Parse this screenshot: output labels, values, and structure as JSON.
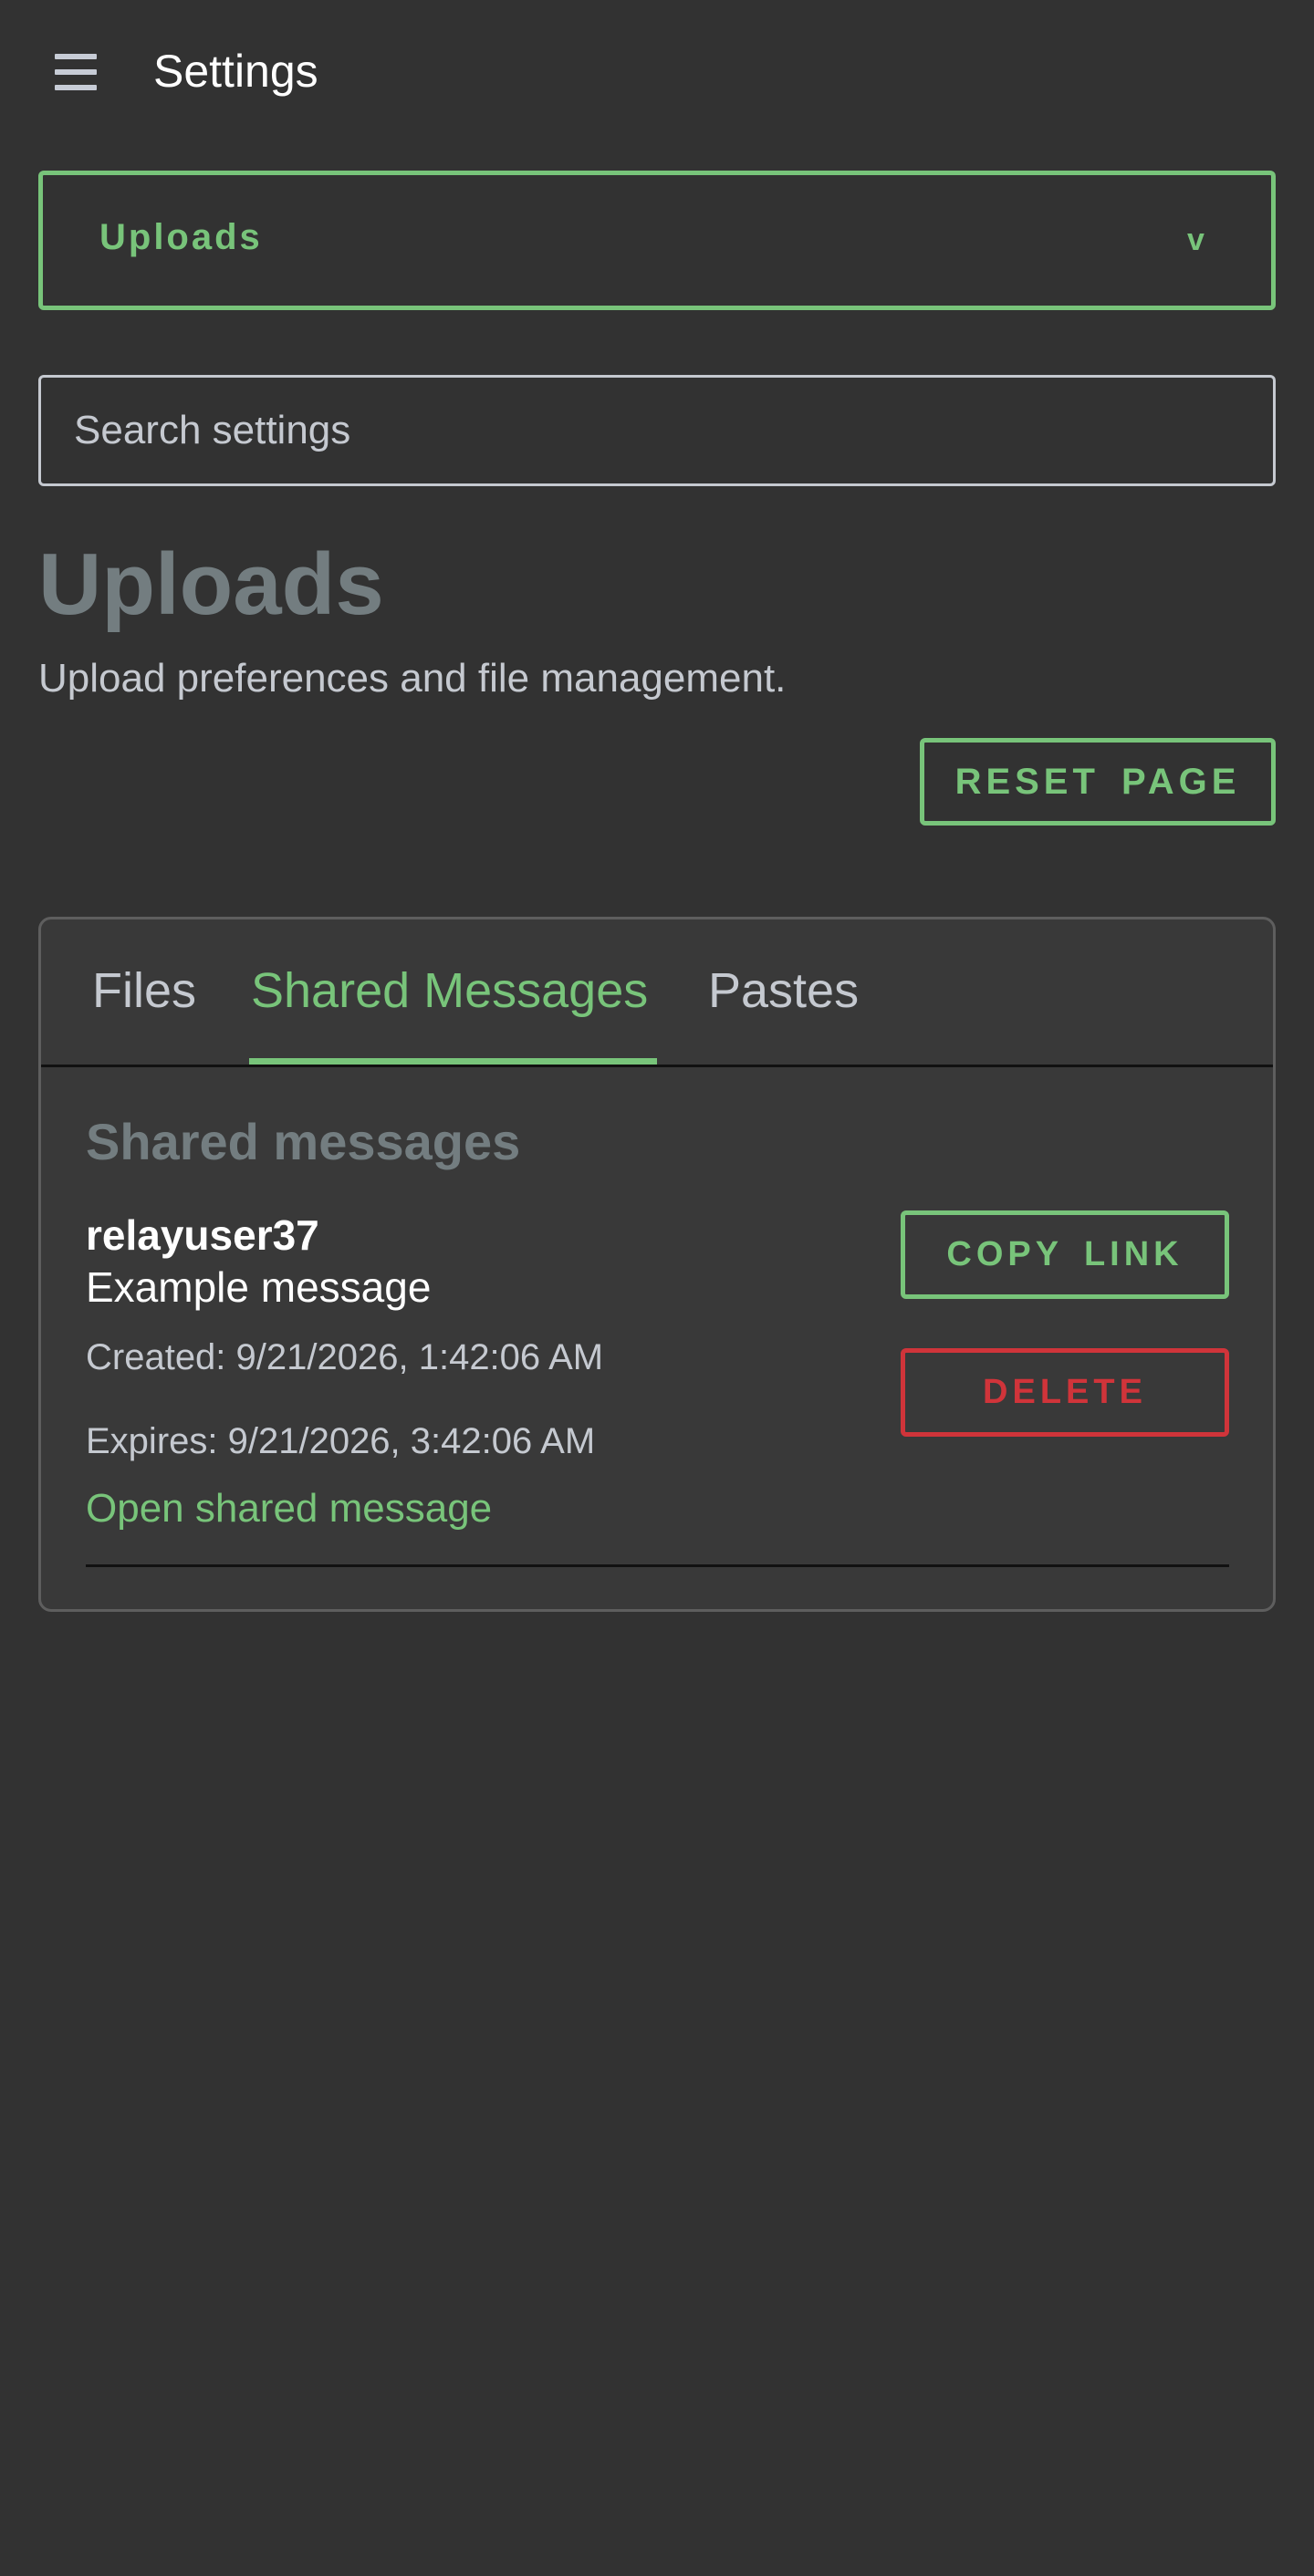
{
  "app_bar": {
    "title": "Settings",
    "menu_icon": "hamburger-menu-icon"
  },
  "category_select": {
    "selected": "Uploads",
    "chevron_icon": "chevron-down-icon",
    "chevron_glyph": "v"
  },
  "search": {
    "placeholder": "Search settings",
    "value": ""
  },
  "page": {
    "title": "Uploads",
    "subtitle": "Upload preferences and file management.",
    "reset_label": "RESET PAGE"
  },
  "tabs": [
    {
      "label": "Files",
      "active": false
    },
    {
      "label": "Shared Messages",
      "active": true
    },
    {
      "label": "Pastes",
      "active": false
    }
  ],
  "shared_messages": {
    "section_title": "Shared messages",
    "items": [
      {
        "user": "relayuser37",
        "text": "Example message",
        "created": "Created: 9/21/2026, 1:42:06 AM",
        "expires": "Expires: 9/21/2026, 3:42:06 AM",
        "link_label": "Open shared message",
        "copy_label": "COPY LINK",
        "delete_label": "DELETE"
      }
    ]
  },
  "colors": {
    "background": "#323232",
    "panel": "#393939",
    "accent": "#78c47a",
    "danger": "#d0343a",
    "muted_text": "#737d80",
    "secondary_text": "#c5c9d0"
  }
}
